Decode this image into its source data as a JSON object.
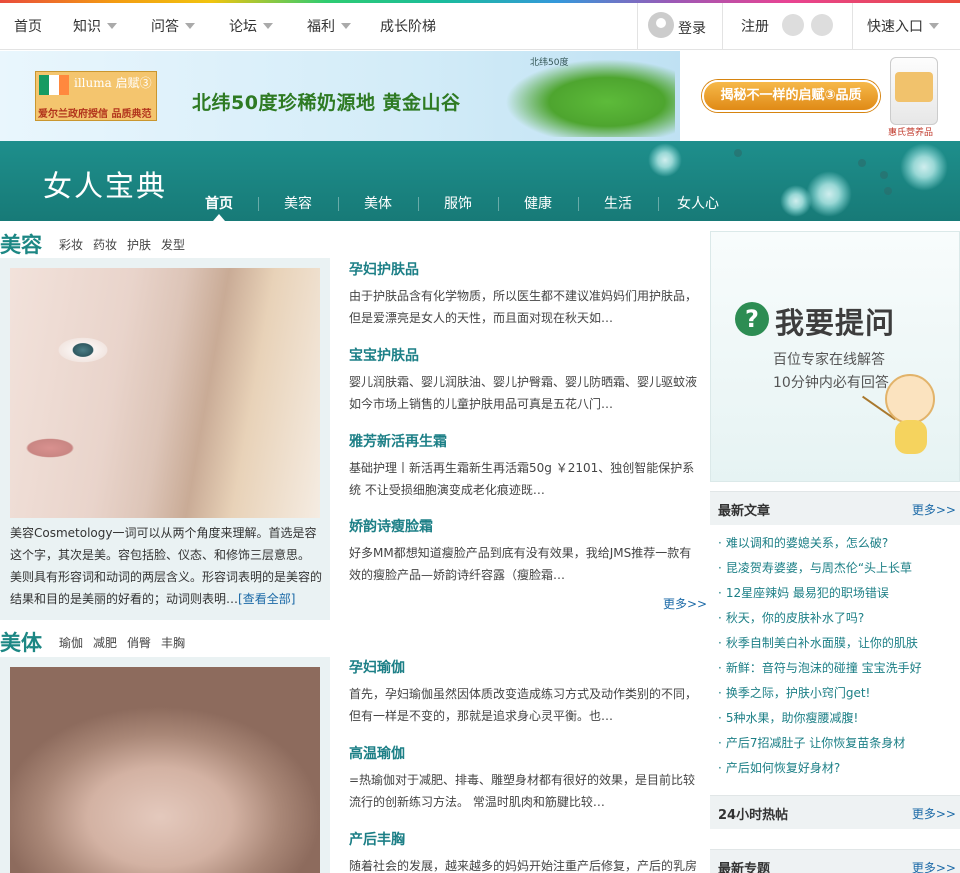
{
  "topnav": {
    "home": "首页",
    "knowledge": "知识",
    "qa": "问答",
    "forum": "论坛",
    "welfare": "福利",
    "growth": "成长阶梯",
    "login": "登录",
    "register": "注册",
    "quick_entry": "快速入口"
  },
  "banner": {
    "brand": "illuma 启赋③",
    "brand_sub": "爱尔兰政府授信 品质典范",
    "headline": "北纬50度珍稀奶源地 黄金山谷",
    "map_label": "北纬50度",
    "cta": "揭秘不一样的启赋③品质",
    "can_caption": "惠氏营养品"
  },
  "channel": {
    "title": "女人宝典",
    "tabs": [
      "首页",
      "美容",
      "美体",
      "服饰",
      "健康",
      "生活",
      "女人心"
    ],
    "active_tab": "首页"
  },
  "beauty": {
    "name": "美容",
    "subs": [
      "彩妆",
      "药妆",
      "护肤",
      "发型"
    ],
    "desc": "美容Cosmetology一词可以从两个角度来理解。首选是容这个字，其次是美。容包括脸、仪态、和修饰三层意思。 美则具有形容词和动词的两层含义。形容词表明的是美容的结果和目的是美丽的好看的；动词则表明…",
    "more_link": "[查看全部]",
    "articles": [
      {
        "title": "孕妇护肤品",
        "text": "由于护肤品含有化学物质，所以医生都不建议准妈妈们用护肤品，但是爱漂亮是女人的天性，而且面对现在秋天如…"
      },
      {
        "title": "宝宝护肤品",
        "text": "婴儿润肤霜、婴儿润肤油、婴儿护臀霜、婴儿防晒霜、婴儿驱蚊液如今市场上销售的儿童护肤用品可真是五花八门…"
      },
      {
        "title": "雅芳新活再生霜",
        "text": "基础护理丨新活再生霜新生再活霜50g ￥2101、独创智能保护系统 不让受损细胞演变成老化痕迹既…"
      },
      {
        "title": "娇韵诗瘦脸霜",
        "text": "好多MM都想知道瘦脸产品到底有没有效果，我给JMS推荐一款有效的瘦脸产品—娇韵诗纤容露（瘦脸霜…"
      }
    ],
    "more": "更多>>"
  },
  "body_section": {
    "name": "美体",
    "subs": [
      "瑜伽",
      "减肥",
      "俏臀",
      "丰胸"
    ],
    "articles": [
      {
        "title": "孕妇瑜伽",
        "text": "首先，孕妇瑜伽虽然因体质改变造成练习方式及动作类别的不同，但有一样是不变的，那就是追求身心灵平衡。也…"
      },
      {
        "title": "高温瑜伽",
        "text": "=热瑜伽对于减肥、排毒、雕塑身材都有很好的效果，是目前比较流行的创新练习方法。 常温时肌肉和筋腱比较…"
      },
      {
        "title": "产后丰胸",
        "text": "随着社会的发展，越来越多的妈妈开始注重产后修复，产后的乳房"
      }
    ]
  },
  "ask": {
    "icon": "?",
    "title": "我要提问",
    "line1": "百位专家在线解答",
    "line2": "10分钟内必有回答"
  },
  "latest": {
    "title": "最新文章",
    "more": "更多>>",
    "items": [
      "难以调和的婆媳关系，怎么破?",
      "昆凌贺寿婆婆，与周杰伦“头上长草",
      "12星座辣妈 最易犯的职场错误",
      "秋天，你的皮肤补水了吗?",
      "秋季自制美白补水面膜，让你的肌肤",
      "新鲜：音符与泡沫的碰撞 宝宝洗手好",
      "换季之际，护肤小窍门get!",
      "5种水果，助你瘦腰减腹!",
      "产后7招减肚子 让你恢复苗条身材",
      "产后如何恢复好身材?"
    ]
  },
  "hot24": {
    "title": "24小时热帖",
    "more": "更多>>"
  },
  "topics": {
    "title": "最新专题",
    "more": "更多>>"
  },
  "colors": {
    "teal": "#1c8784",
    "link": "#1c6aa7",
    "accent": "#e08a16"
  }
}
